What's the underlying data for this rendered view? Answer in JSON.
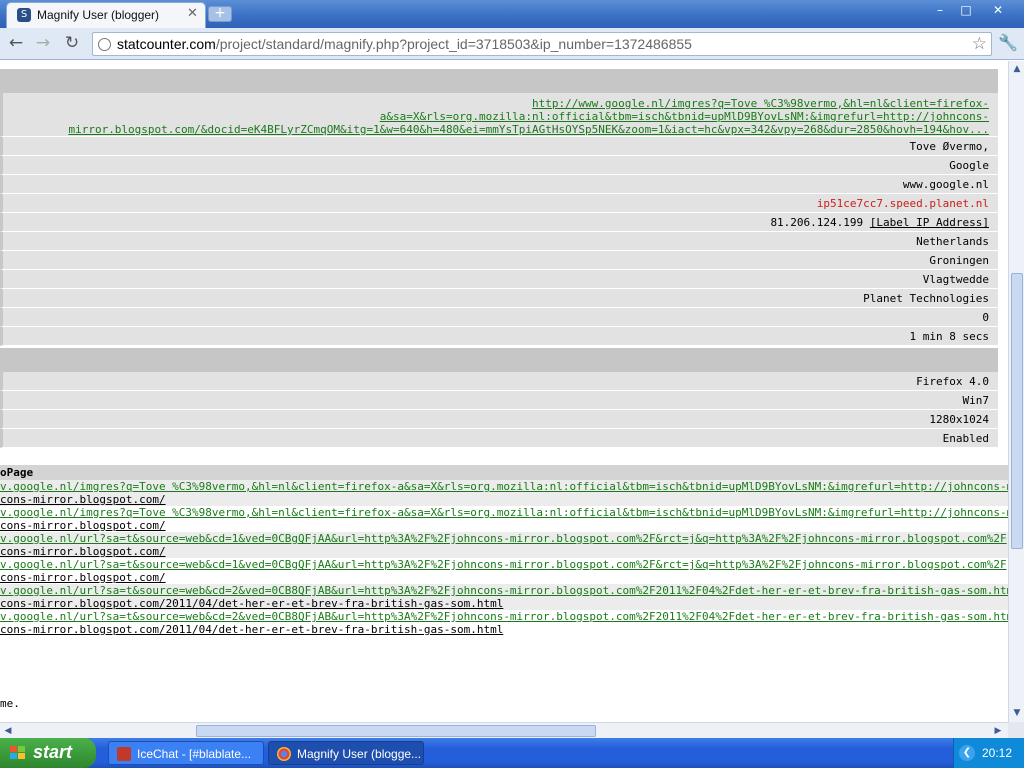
{
  "window": {
    "tab_title": "Magnify User (blogger)",
    "tab_favicon": "statcounter-icon",
    "minimize": "–",
    "maximize": "□",
    "close": "✕",
    "newtab": "+"
  },
  "toolbar": {
    "back": "←",
    "forward": "→",
    "reload": "↻",
    "url_host": "statcounter.com",
    "url_path": "/project/standard/magnify.php?project_id=3718503&ip_number=1372486855",
    "star": "☆",
    "wrench": "🔧"
  },
  "visit_details": {
    "referring_link_line1": "http://www.google.nl/imgres?q=Tove %C3%98vermo,&hl=nl&client=firefox-",
    "referring_link_line2": "a&sa=X&rls=org.mozilla:nl:official&tbm=isch&tbnid=upMlD9BYovLsNM:&imgrefurl=http://johncons-",
    "referring_link_line3": "mirror.blogspot.com/&docid=eK4BFLyrZCmqOM&itg=1&w=640&h=480&ei=mmYsTpiAGtHsOYSp5NEK&zoom=1&iact=hc&vpx=342&vpy=268&dur=2850&hovh=194&hov...",
    "search_words": "Tove Øvermo,",
    "search_engine": "Google",
    "search_host": "www.google.nl",
    "host_name": "ip51ce7cc7.speed.planet.nl",
    "ip_address": "81.206.124.199",
    "label_ip": "[Label IP Address]",
    "country": "Netherlands",
    "region": "Groningen",
    "city": "Vlagtwedde",
    "isp": "Planet Technologies",
    "returning_visits": "0",
    "visit_length": "1 min 8 secs"
  },
  "system": {
    "browser": "Firefox 4.0",
    "os": "Win7",
    "resolution": "1280x1024",
    "javascript": "Enabled"
  },
  "page_views": {
    "header": "oPage",
    "entries": [
      {
        "referrer": "v.google.nl/imgres?q=Tove %C3%98vermo,&hl=nl&client=firefox-a&sa=X&rls=org.mozilla:nl:official&tbm=isch&tbnid=upMlD9BYovLsNM:&imgrefurl=http://johncons-mirror.blogsp",
        "page": "cons-mirror.blogspot.com/"
      },
      {
        "referrer": "v.google.nl/imgres?q=Tove %C3%98vermo,&hl=nl&client=firefox-a&sa=X&rls=org.mozilla:nl:official&tbm=isch&tbnid=upMlD9BYovLsNM:&imgrefurl=http://johncons-mirror.blogsp",
        "page": "cons-mirror.blogspot.com/"
      },
      {
        "referrer": "v.google.nl/url?sa=t&source=web&cd=1&ved=0CBgQFjAA&url=http%3A%2F%2Fjohncons-mirror.blogspot.com%2F&rct=j&q=http%3A%2F%2Fjohncons-mirror.blogspot.com%2F",
        "page": "cons-mirror.blogspot.com/"
      },
      {
        "referrer": "v.google.nl/url?sa=t&source=web&cd=1&ved=0CBgQFjAA&url=http%3A%2F%2Fjohncons-mirror.blogspot.com%2F&rct=j&q=http%3A%2F%2Fjohncons-mirror.blogspot.com%2F",
        "page": "cons-mirror.blogspot.com/"
      },
      {
        "referrer": "v.google.nl/url?sa=t&source=web&cd=2&ved=0CB8QFjAB&url=http%3A%2F%2Fjohncons-mirror.blogspot.com%2F2011%2F04%2Fdet-her-er-et-brev-fra-british-gas-som.html&rct",
        "page": "cons-mirror.blogspot.com/2011/04/det-her-er-et-brev-fra-british-gas-som.html"
      },
      {
        "referrer": "v.google.nl/url?sa=t&source=web&cd=2&ved=0CB8QFjAB&url=http%3A%2F%2Fjohncons-mirror.blogspot.com%2F2011%2F04%2Fdet-her-er-et-brev-fra-british-gas-som.html&rct",
        "page": "cons-mirror.blogspot.com/2011/04/det-her-er-et-brev-fra-british-gas-som.html"
      }
    ]
  },
  "footer_text": "me.",
  "scroll": {
    "up": "▲",
    "down": "▼",
    "left": "◀",
    "right": "▶"
  },
  "taskbar": {
    "start_label": "start",
    "tasks": [
      {
        "label": "IceChat - [#blablate..."
      },
      {
        "label": "Magnify User (blogge..."
      }
    ],
    "tray_arrow": "❮",
    "clock": "20:12"
  },
  "colors": {
    "link_green": "#1a7a1a",
    "host_red": "#c8201c",
    "row_bg": "#e2e2e2",
    "header_bg": "#c6c6c6",
    "taskbar_blue": "#245edb",
    "start_green": "#3c9c3c"
  }
}
